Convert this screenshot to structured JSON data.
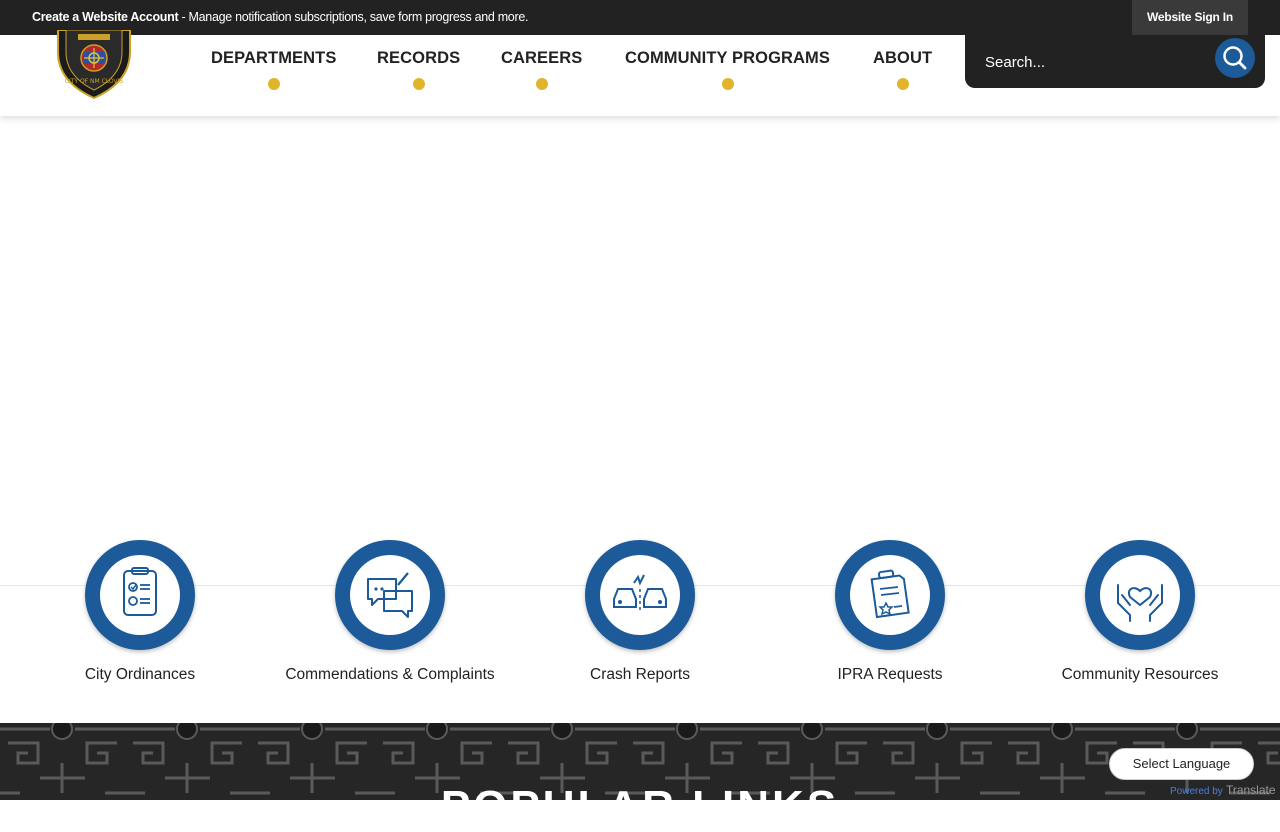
{
  "topbar": {
    "account_link": "Create a Website Account",
    "account_text": " - Manage notification subscriptions, save form progress and more.",
    "signin_label": "Website Sign In"
  },
  "logo": {
    "text": "CITY OF NM CLOVIS"
  },
  "nav": {
    "departments": "DEPARTMENTS",
    "records": "RECORDS",
    "careers": "CAREERS",
    "community_programs": "COMMUNITY PROGRAMS",
    "about": "ABOUT"
  },
  "search": {
    "placeholder": "Search..."
  },
  "quick_links": [
    {
      "label": "City Ordinances",
      "icon": "clipboard-checklist-icon"
    },
    {
      "label": "Commendations & Complaints",
      "icon": "chat-bubbles-icon"
    },
    {
      "label": "Crash Reports",
      "icon": "car-crash-icon"
    },
    {
      "label": "IPRA Requests",
      "icon": "document-request-icon"
    },
    {
      "label": "Community Resources",
      "icon": "hands-heart-icon"
    }
  ],
  "footer": {
    "popular_heading": "POPULAR LINKS",
    "translate_label": "Select Language",
    "powered_by": "Powered by",
    "translate_word": "Translate"
  },
  "colors": {
    "accent_blue": "#1c5a99",
    "nav_dot": "#e0b52c",
    "topbar_bg": "#222222"
  }
}
